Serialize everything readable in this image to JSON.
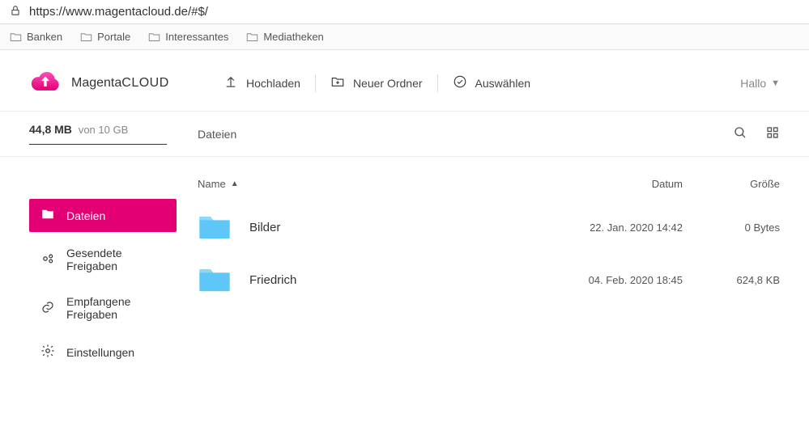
{
  "url": "https://www.magentacloud.de/#$/",
  "bookmarks": [
    {
      "label": "Banken"
    },
    {
      "label": "Portale"
    },
    {
      "label": "Interessantes"
    },
    {
      "label": "Mediatheken"
    }
  ],
  "brand": {
    "name1": "Magenta",
    "name2": "CLOUD",
    "color": "#e20074"
  },
  "toolbar": {
    "upload_label": "Hochladen",
    "new_folder_label": "Neuer Ordner",
    "select_label": "Auswählen"
  },
  "user": {
    "greeting": "Hallo"
  },
  "storage": {
    "used": "44,8 MB",
    "von_text": "von",
    "total": "10 GB"
  },
  "breadcrumb": "Dateien",
  "nav": {
    "items": [
      {
        "label": "Dateien",
        "active": true
      },
      {
        "label": "Gesendete Freigaben",
        "active": false
      },
      {
        "label": "Empfangene Freigaben",
        "active": false
      },
      {
        "label": "Einstellungen",
        "active": false
      }
    ]
  },
  "table": {
    "headers": {
      "name": "Name",
      "date": "Datum",
      "size": "Größe"
    },
    "rows": [
      {
        "name": "Bilder",
        "date": "22. Jan. 2020 14:42",
        "size": "0 Bytes"
      },
      {
        "name": "Friedrich",
        "date": "04. Feb. 2020 18:45",
        "size": "624,8 KB"
      }
    ]
  }
}
